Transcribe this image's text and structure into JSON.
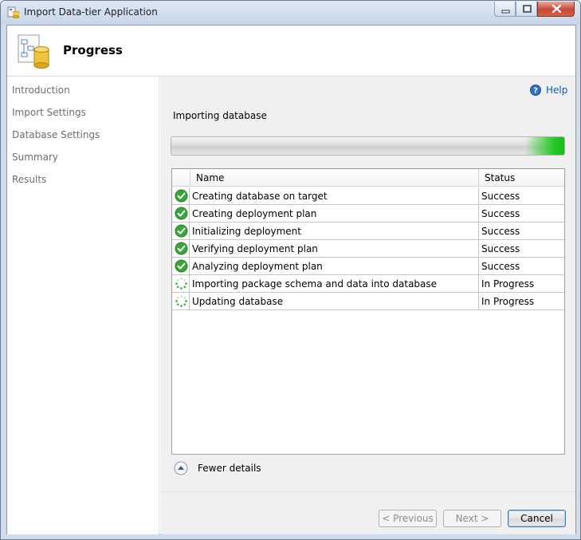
{
  "window": {
    "title": "Import Data-tier Application"
  },
  "header": {
    "title": "Progress"
  },
  "sidebar": {
    "items": [
      {
        "label": "Introduction"
      },
      {
        "label": "Import Settings"
      },
      {
        "label": "Database Settings"
      },
      {
        "label": "Summary"
      },
      {
        "label": "Results"
      }
    ]
  },
  "main": {
    "help_label": "Help",
    "status_text": "Importing database",
    "progress_fraction": 0.1,
    "table": {
      "columns": [
        "Name",
        "Status"
      ],
      "rows": [
        {
          "name": "Creating database on target",
          "status": "Success",
          "icon": "success-check-icon"
        },
        {
          "name": "Creating deployment plan",
          "status": "Success",
          "icon": "success-check-icon"
        },
        {
          "name": "Initializing deployment",
          "status": "Success",
          "icon": "success-check-icon"
        },
        {
          "name": "Verifying deployment plan",
          "status": "Success",
          "icon": "success-check-icon"
        },
        {
          "name": "Analyzing deployment plan",
          "status": "Success",
          "icon": "success-check-icon"
        },
        {
          "name": "Importing package schema and data into database",
          "status": "In Progress",
          "icon": "in-progress-spinner-icon"
        },
        {
          "name": "Updating database",
          "status": "In Progress",
          "icon": "in-progress-spinner-icon"
        }
      ]
    },
    "details_toggle_label": "Fewer details"
  },
  "footer": {
    "previous_label": "< Previous",
    "next_label": "Next >",
    "cancel_label": "Cancel"
  },
  "colors": {
    "success": "#3aa53a",
    "progress_glow": "#22c322",
    "link": "#0c5fb8"
  }
}
